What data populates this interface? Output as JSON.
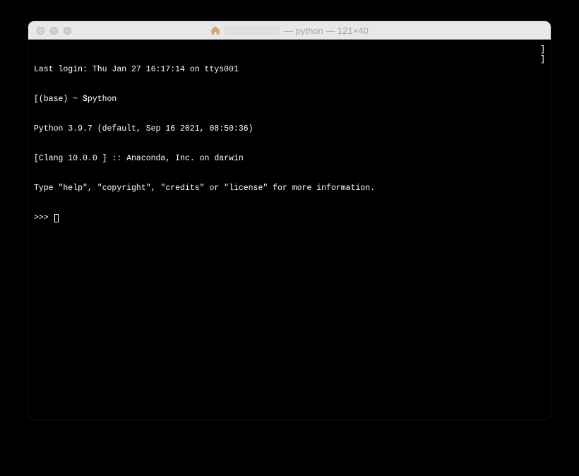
{
  "window": {
    "title_suffix": " — python — 121×40"
  },
  "terminal": {
    "lines": {
      "last_login": "Last login: Thu Jan 27 16:17:14 on ttys001",
      "prompt_cmd": "(base) ~ $python",
      "py_version": "Python 3.9.7 (default, Sep 16 2021, 08:50:36)",
      "clang": "[Clang 10.0.0 ] :: Anaconda, Inc. on darwin",
      "help": "Type \"help\", \"copyright\", \"credits\" or \"license\" for more information.",
      "repl_prompt": ">>> "
    },
    "left_bracket": "[",
    "right_bracket": "]"
  }
}
